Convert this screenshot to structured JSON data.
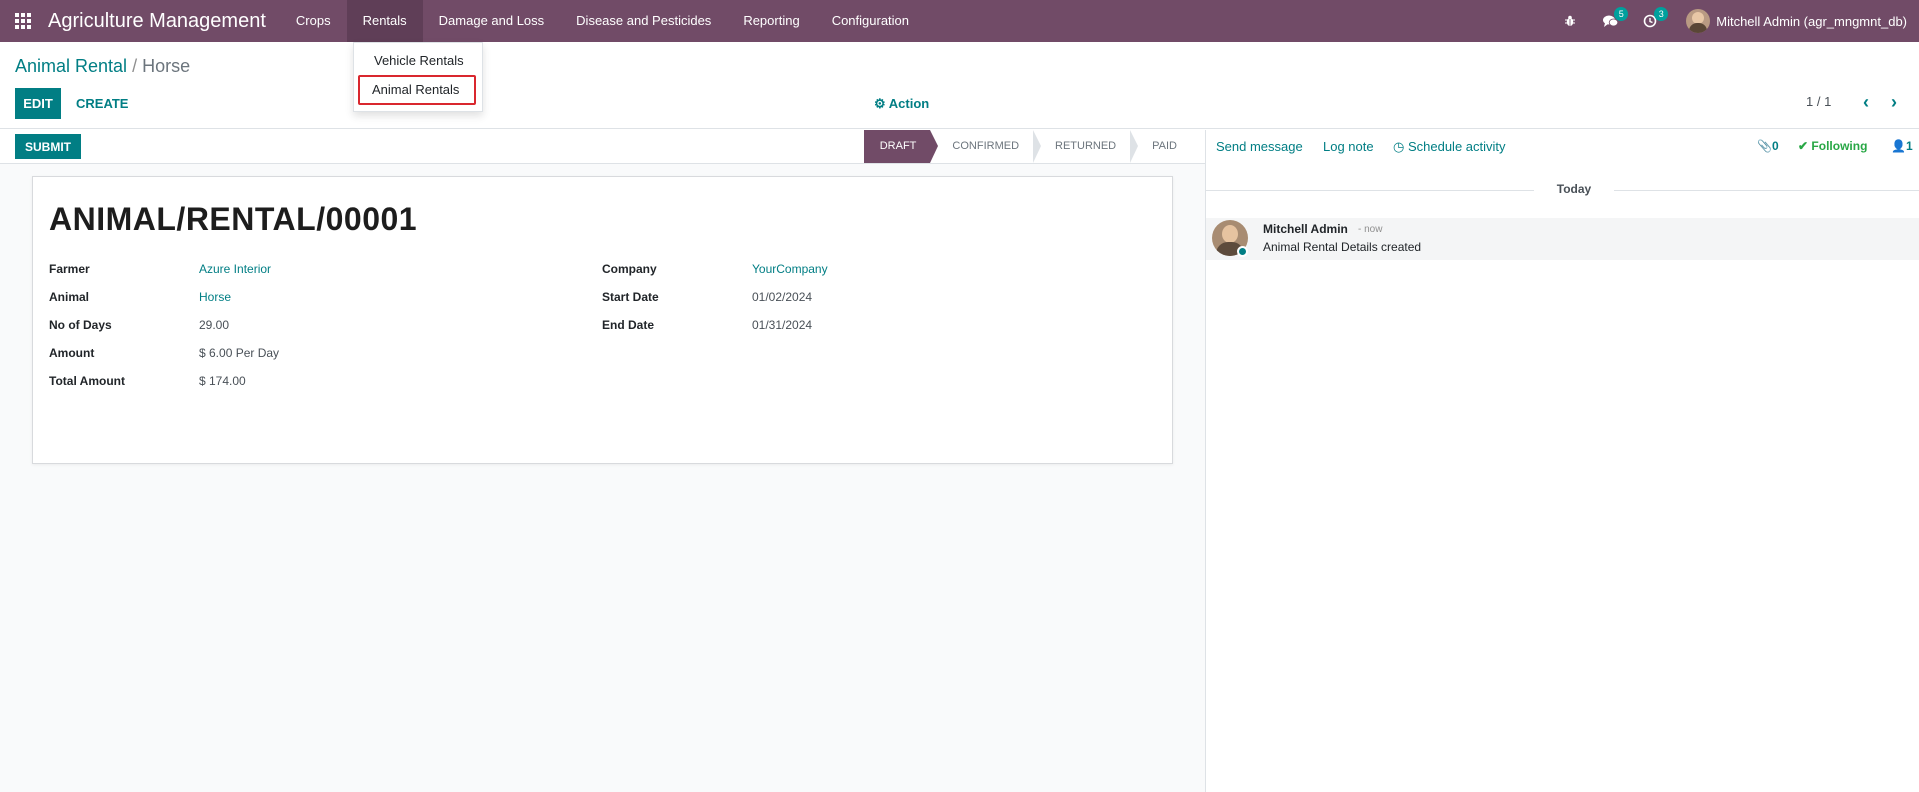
{
  "navbar": {
    "brand": "Agriculture Management",
    "menu": [
      "Crops",
      "Rentals",
      "Damage and Loss",
      "Disease and Pesticides",
      "Reporting",
      "Configuration"
    ],
    "messages_count": "5",
    "activities_count": "3",
    "user": "Mitchell Admin (agr_mngmnt_db)"
  },
  "dropdown": {
    "items": [
      "Vehicle Rentals",
      "Animal Rentals"
    ]
  },
  "control_panel": {
    "breadcrumb_parent": "Animal Rental",
    "breadcrumb_sep": "/",
    "breadcrumb_current": "Horse",
    "edit_label": "EDIT",
    "create_label": "CREATE",
    "action_label": "Action",
    "pager": "1 / 1"
  },
  "statusbar": {
    "submit_label": "SUBMIT",
    "stages": [
      "DRAFT",
      "CONFIRMED",
      "RETURNED",
      "PAID"
    ]
  },
  "form": {
    "name": "ANIMAL/RENTAL/00001",
    "left": [
      {
        "label": "Farmer",
        "value": "Azure Interior"
      },
      {
        "label": "Animal",
        "value": "Horse"
      },
      {
        "label": "No of Days",
        "value": "29.00"
      },
      {
        "label": "Amount",
        "value": "$ 6.00 Per Day"
      },
      {
        "label": "Total Amount",
        "value": "$ 174.00"
      }
    ],
    "right": [
      {
        "label": "Company",
        "value": "YourCompany"
      },
      {
        "label": "Start Date",
        "value": "01/02/2024"
      },
      {
        "label": "End Date",
        "value": "01/31/2024"
      }
    ]
  },
  "chatter": {
    "send_message": "Send message",
    "log_note": "Log note",
    "schedule_activity": "Schedule activity",
    "attachments_count": "0",
    "following_label": "Following",
    "followers_count": "1",
    "date_separator": "Today",
    "message": {
      "author": "Mitchell Admin",
      "date": "- now",
      "body": "Animal Rental Details created"
    }
  },
  "colors": {
    "brand": "#714B67",
    "accent": "#017e84",
    "following": "#28a745",
    "highlight_border": "#d9272e"
  }
}
